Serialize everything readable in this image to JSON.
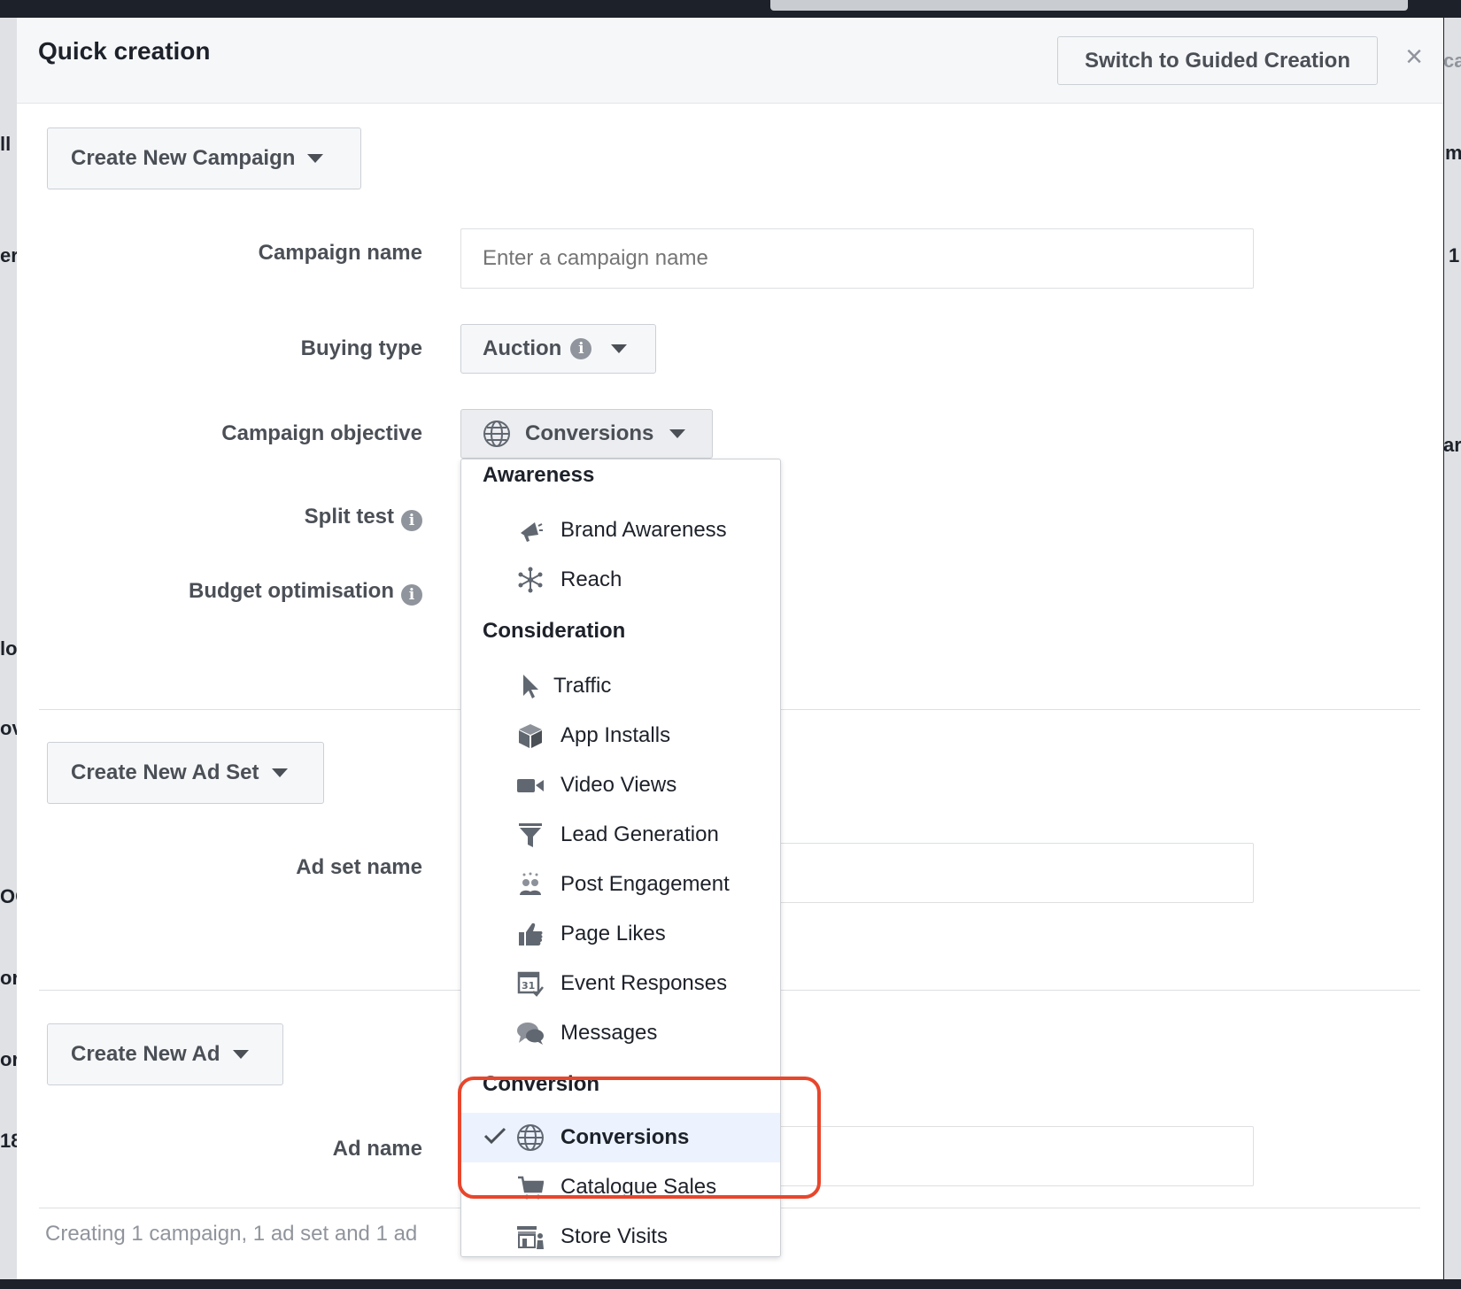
{
  "header": {
    "title": "Quick creation",
    "guided_button": "Switch to Guided Creation",
    "close": "×"
  },
  "campaign": {
    "section_button": "Create New Campaign",
    "name_label": "Campaign name",
    "name_placeholder": "Enter a campaign name",
    "buying_type_label": "Buying type",
    "buying_type_value": "Auction",
    "objective_label": "Campaign objective",
    "objective_value": "Conversions",
    "split_test_label": "Split test",
    "budget_label": "Budget optimisation"
  },
  "ad_set": {
    "section_button": "Create New Ad Set",
    "name_label": "Ad set name"
  },
  "ad": {
    "section_button": "Create New Ad",
    "name_label": "Ad name"
  },
  "footer": {
    "summary": "Creating 1 campaign, 1 ad set and 1 ad"
  },
  "dropdown": {
    "groups": [
      {
        "label": "Awareness"
      },
      {
        "label": "Consideration"
      },
      {
        "label": "Conversion"
      }
    ],
    "items": [
      {
        "label": "Brand Awareness",
        "icon": "megaphone-icon"
      },
      {
        "label": "Reach",
        "icon": "reach-icon"
      },
      {
        "label": "Traffic",
        "icon": "cursor-icon"
      },
      {
        "label": "App Installs",
        "icon": "box-icon"
      },
      {
        "label": "Video Views",
        "icon": "video-camera-icon"
      },
      {
        "label": "Lead Generation",
        "icon": "funnel-icon"
      },
      {
        "label": "Post Engagement",
        "icon": "people-icon"
      },
      {
        "label": "Page Likes",
        "icon": "thumbs-up-icon"
      },
      {
        "label": "Event Responses",
        "icon": "calendar-icon"
      },
      {
        "label": "Messages",
        "icon": "chat-bubbles-icon"
      },
      {
        "label": "Conversions",
        "icon": "globe-icon",
        "selected": true
      },
      {
        "label": "Catalogue Sales",
        "icon": "cart-icon"
      },
      {
        "label": "Store Visits",
        "icon": "store-icon"
      }
    ]
  },
  "background_fragments": [
    "ll",
    "ers",
    "1",
    "lo",
    "ov",
    "OC",
    "or",
    "or",
    "18",
    "ca",
    "m",
    "ar"
  ],
  "colors": {
    "highlight": "#e8462c",
    "selected_row": "#ecf3ff",
    "icon_gray": "#606770"
  }
}
